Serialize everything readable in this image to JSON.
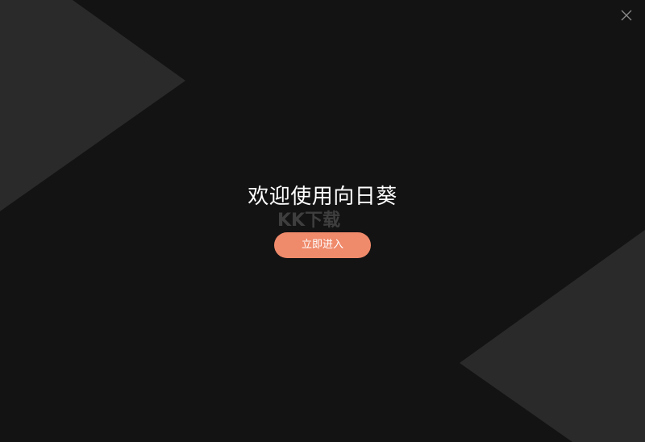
{
  "welcome_title": "欢迎使用向日葵",
  "enter_button_label": "立即进入",
  "close_icon": "close-icon",
  "colors": {
    "background": "#131313",
    "decor": "#2a2a2a",
    "accent": "#ef8a6b",
    "text": "#ffffff"
  }
}
